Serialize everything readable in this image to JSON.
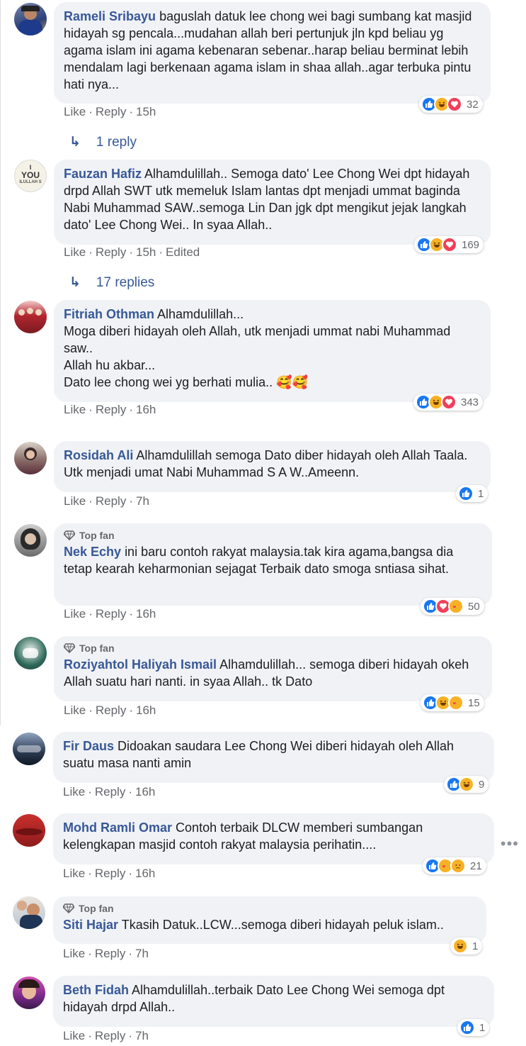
{
  "comments": [
    {
      "name": "Rameli Sribayu",
      "text": "baguslah datuk lee chong wei bagi sumbang kat masjid hidayah sg pencala...mudahan allah beri pertunjuk jln kpd beliau yg agama islam ini agama kebenaran sebenar..harap beliau berminat lebih mendalam lagi berkenaan agama islam in shaa allah..agar terbuka pintu hati nya...",
      "like": "Like",
      "reply": "Reply",
      "time": "15h",
      "reactions": "32",
      "replies": "1 reply"
    },
    {
      "name": "Fauzan Hafiz",
      "text": "Alhamdulillah.. Semoga dato' Lee Chong Wei dpt hidayah drpd Allah SWT utk memeluk Islam lantas dpt menjadi ummat baginda Nabi Muhammad SAW..semoga Lin Dan jgk dpt mengikut jejak langkah dato' Lee Chong Wei.. In syaa Allah..",
      "like": "Like",
      "reply": "Reply",
      "time": "15h",
      "edited": "Edited",
      "reactions": "169",
      "replies": "17 replies"
    },
    {
      "name": "Fitriah Othman",
      "text": "Alhamdulillah...",
      "line2": "Moga diberi hidayah oleh Allah, utk menjadi ummat nabi Muhammad saw..",
      "line3": "Allah hu akbar...",
      "line4": "Dato lee chong wei yg berhati mulia..",
      "emoji": "🥰🥰",
      "like": "Like",
      "reply": "Reply",
      "time": "16h",
      "reactions": "343"
    },
    {
      "name": "Rosidah Ali",
      "text": "Alhamdulillah semoga Dato diber hidayah oleh Allah Taala. Utk menjadi umat Nabi Muhammad S A W..Ameenn.",
      "like": "Like",
      "reply": "Reply",
      "time": "7h",
      "reactions": "1"
    },
    {
      "badge": "Top fan",
      "name": "Nek Echy",
      "text": "ini baru contoh rakyat malaysia.tak kira agama,bangsa dia tetap kearah keharmonian sejagat Terbaik dato smoga sntiasa sihat.",
      "like": "Like",
      "reply": "Reply",
      "time": "16h",
      "reactions": "50"
    },
    {
      "badge": "Top fan",
      "name": "Roziyahtol Haliyah Ismail",
      "text": "Alhamdulillah... semoga diberi hidayah okeh Allah suatu hari nanti. in syaa Allah.. tk Dato",
      "like": "Like",
      "reply": "Reply",
      "time": "16h",
      "reactions": "15"
    },
    {
      "name": "Fir Daus",
      "text": "Didoakan saudara Lee Chong Wei diberi hidayah oleh Allah suatu masa nanti amin",
      "like": "Like",
      "reply": "Reply",
      "time": "16h",
      "reactions": "9"
    },
    {
      "name": "Mohd Ramli Omar",
      "text": "Contoh terbaik DLCW memberi sumbangan kelengkapan masjid contoh rakyat malaysia perihatin....",
      "like": "Like",
      "reply": "Reply",
      "time": "16h",
      "reactions": "21"
    },
    {
      "badge": "Top fan",
      "name": "Siti Hajar",
      "text": "Tkasih Datuk..LCW...semoga diberi hidayah peluk islam..",
      "like": "Like",
      "reply": "Reply",
      "time": "7h",
      "reactions": "1"
    },
    {
      "name": "Beth Fidah",
      "text": "Alhamdulillah..terbaik Dato Lee Chong Wei semoga dpt hidayah drpd Allah..",
      "like": "Like",
      "reply": "Reply",
      "time": "7h",
      "reactions": "1"
    }
  ],
  "more": "•••",
  "reply_arrow": "↳",
  "avatar_text": {
    "fauzan_i": "I",
    "fauzan_you": "YOU",
    "fauzan_sub": "ILULLAH S"
  },
  "colors": {
    "link": "#385898",
    "bubble": "#f0f2f5",
    "like": "#1877f2",
    "haha": "#f7b125",
    "love": "#f33e58"
  }
}
